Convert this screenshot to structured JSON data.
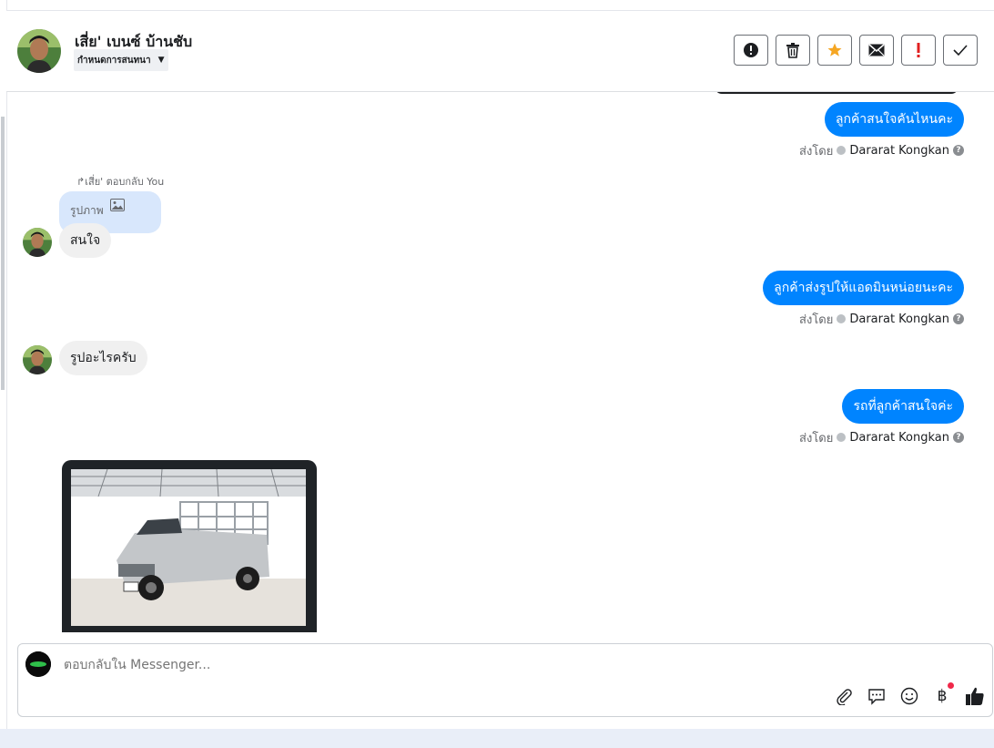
{
  "header": {
    "contact_name": "เสี่ย' เบนซ์ บ้านชับ",
    "tag_label": "กำหนดการสนทนา",
    "actions": [
      {
        "name": "report-button",
        "icon": "exclamation-circle-icon"
      },
      {
        "name": "delete-button",
        "icon": "trash-icon"
      },
      {
        "name": "star-button",
        "icon": "star-icon",
        "color": "#f5a623"
      },
      {
        "name": "mark-unread-button",
        "icon": "envelope-icon"
      },
      {
        "name": "important-button",
        "icon": "exclamation-icon",
        "color": "#e02020"
      },
      {
        "name": "done-button",
        "icon": "check-icon"
      }
    ]
  },
  "messages": {
    "m1": {
      "text": "ลูกค้าสนใจคันไหนคะ",
      "sent_by_label": "ส่งโดย",
      "agent": "Dararat Kongkan"
    },
    "reply": {
      "label": "เสี่ย' ตอบกลับ You",
      "quoted": "รูปภาพ",
      "text": "สนใจ"
    },
    "m2": {
      "text": "ลูกค้าส่งรูปให้แอดมินหน่อยนะคะ",
      "sent_by_label": "ส่งโดย",
      "agent": "Dararat Kongkan"
    },
    "m3": {
      "text": "รูปอะไรครับ"
    },
    "m4": {
      "text": "รถที่ลูกค้าสนใจค่ะ",
      "sent_by_label": "ส่งโดย",
      "agent": "Dararat Kongkan"
    }
  },
  "composer": {
    "placeholder": "ตอบกลับใน Messenger...",
    "tools": [
      "paperclip-icon",
      "saved-reply-icon",
      "emoji-icon",
      "baht-icon",
      "thumbs-up-icon"
    ],
    "baht_symbol": "฿"
  },
  "colors": {
    "accent": "#0084ff",
    "incoming": "#f0f0f0",
    "quote": "#d8e7fc"
  }
}
